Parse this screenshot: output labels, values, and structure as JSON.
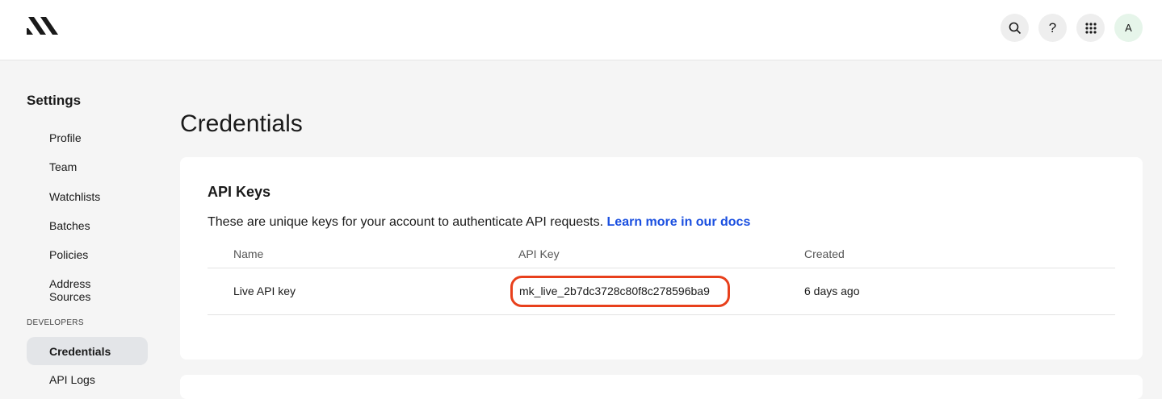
{
  "header": {
    "logo_icon": "brand-logo-icon",
    "search_icon": "search-icon",
    "help_label": "?",
    "apps_icon": "grid-icon",
    "avatar_initial": "A"
  },
  "sidebar": {
    "title": "Settings",
    "items": [
      {
        "label": "Profile"
      },
      {
        "label": "Team"
      },
      {
        "label": "Watchlists"
      },
      {
        "label": "Batches"
      },
      {
        "label": "Policies"
      },
      {
        "label": "Address Sources"
      }
    ],
    "section_label": "DEVELOPERS",
    "dev_items": [
      {
        "label": "Credentials",
        "active": true
      },
      {
        "label": "API Logs"
      }
    ]
  },
  "main": {
    "page_title": "Credentials",
    "card": {
      "title": "API Keys",
      "description": "These are unique keys for your account to authenticate API requests.",
      "docs_link": "Learn more in our docs",
      "columns": [
        "Name",
        "API Key",
        "Created"
      ],
      "rows": [
        {
          "name": "Live API key",
          "key": "mk_live_2b7dc3728c80f8c278596ba9",
          "created": "6 days ago"
        }
      ]
    }
  },
  "colors": {
    "link": "#1a4fe0",
    "highlight": "#e8401c",
    "active_nav": "#e3e5e8"
  }
}
